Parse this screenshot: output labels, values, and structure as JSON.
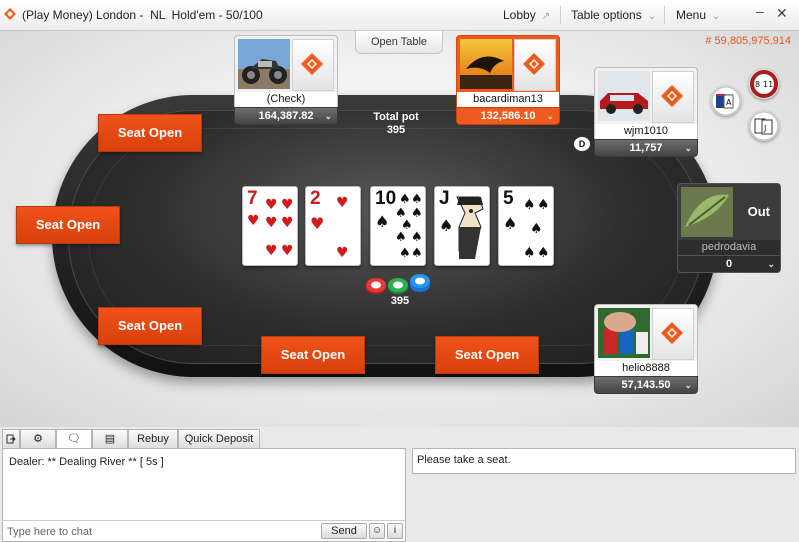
{
  "window": {
    "title": "(Play Money) London -  NL  Hold'em - 50/100",
    "lobby_label": "Lobby",
    "table_options_label": "Table options",
    "menu_label": "Menu"
  },
  "table": {
    "balance": "# 59,805,975,914",
    "open_table_label": "Open Table",
    "total_pot_label": "Total pot",
    "total_pot_value": "395",
    "pot_chips_value": "395",
    "dealer_label": "D",
    "seat_open_label": "Seat Open",
    "players": [
      {
        "name": "(Check)",
        "stack": "164,387.82",
        "avatar": "motorcycle",
        "state": "normal"
      },
      {
        "name": "bacardiman13",
        "stack": "132,586.10",
        "avatar": "dolphin-sunset",
        "state": "active"
      },
      {
        "name": "wjm1010",
        "stack": "11,757",
        "avatar": "red-car",
        "state": "normal"
      },
      {
        "name": "pedrodavia",
        "stack": "0",
        "avatar": "leaves",
        "state": "out",
        "status": "Out"
      },
      {
        "name": "helio8888",
        "stack": "57,143.50",
        "avatar": "poker-chips",
        "state": "normal"
      }
    ],
    "community_cards": [
      {
        "rank": "7",
        "suit": "hearts",
        "color": "#d11b1b"
      },
      {
        "rank": "2",
        "suit": "hearts",
        "color": "#d11b1b"
      },
      {
        "rank": "10",
        "suit": "spades",
        "color": "#111111"
      },
      {
        "rank": "J",
        "suit": "spades",
        "color": "#111111"
      },
      {
        "rank": "5",
        "suit": "spades",
        "color": "#111111"
      }
    ],
    "accent_color": "#ef5a1e"
  },
  "bottom": {
    "tabs": [
      "Rebuy",
      "Quick Deposit"
    ],
    "chat_line": "Dealer: ** Dealing River ** [ 5s ]",
    "chat_placeholder": "Type here to chat",
    "send_label": "Send",
    "info_label": "i",
    "status_message": "Please take a seat."
  }
}
